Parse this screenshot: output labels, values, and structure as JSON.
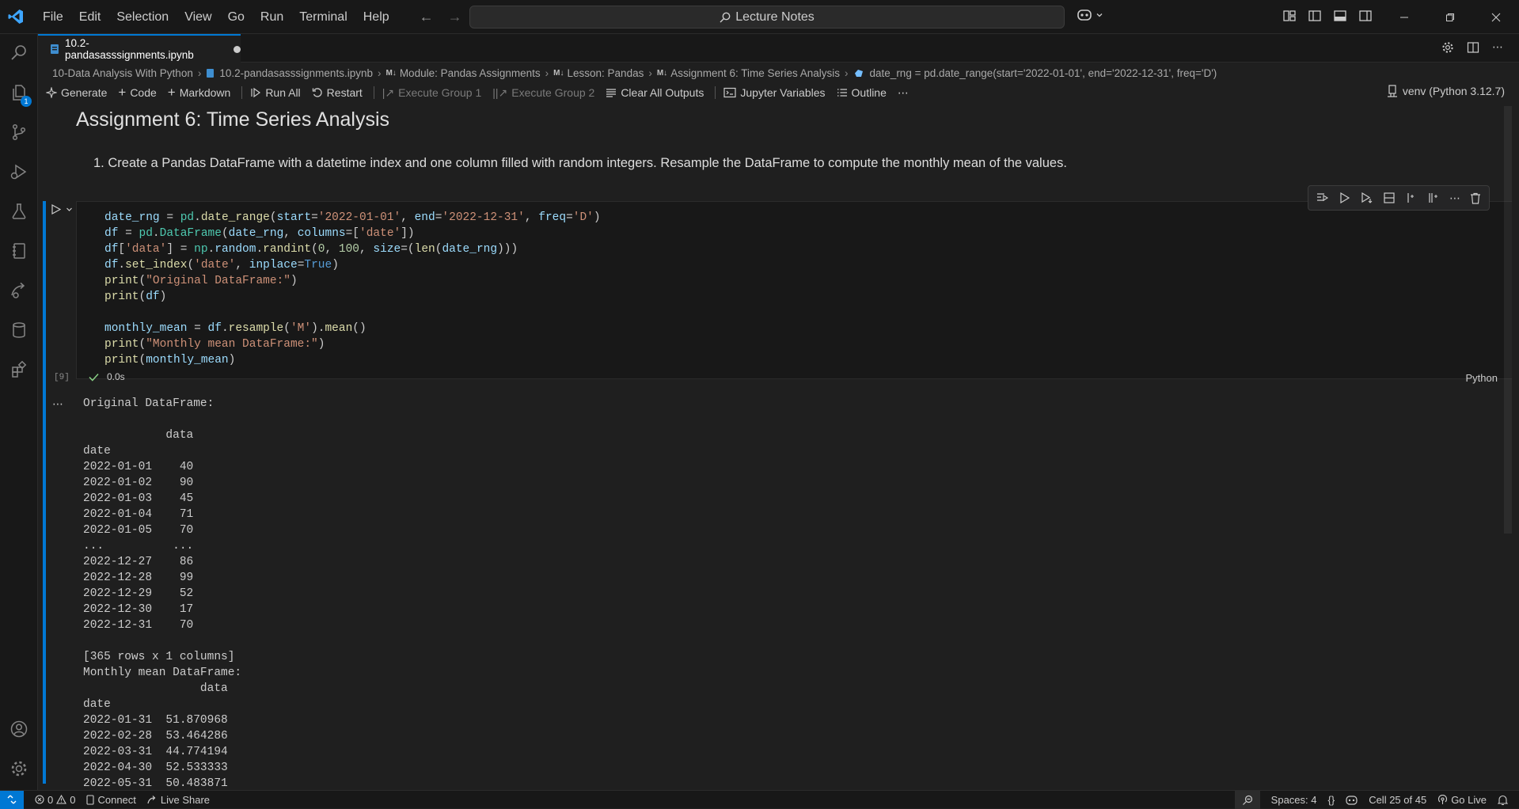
{
  "menu": [
    "File",
    "Edit",
    "Selection",
    "View",
    "Go",
    "Run",
    "Terminal",
    "Help"
  ],
  "search": {
    "text": "Lecture Notes"
  },
  "activity": {
    "explorer_badge": "1"
  },
  "tab": {
    "filename": "10.2-pandasasssignments.ipynb"
  },
  "breadcrumb": {
    "folder": "10-Data Analysis With Python",
    "file": "10.2-pandasasssignments.ipynb",
    "module": "Module: Pandas Assignments",
    "lesson": "Lesson: Pandas",
    "assignment": "Assignment 6: Time Series Analysis",
    "symbol": "date_rng = pd.date_range(start='2022-01-01', end='2022-12-31', freq='D')",
    "md_marker": "M↓"
  },
  "toolbar": {
    "generate": "Generate",
    "code": "Code",
    "markdown": "Markdown",
    "run_all": "Run All",
    "restart": "Restart",
    "exec_group_1": "Execute Group 1",
    "exec_group_2": "Execute Group 2",
    "clear_outputs": "Clear All Outputs",
    "jupyter_vars": "Jupyter Variables",
    "outline": "Outline",
    "more": "⋯",
    "kernel": "venv (Python 3.12.7)"
  },
  "markdown_cell": {
    "heading": "Assignment 6: Time Series Analysis",
    "item_number": "1.",
    "item": "Create a Pandas DataFrame with a datetime index and one column filled with random integers. Resample the DataFrame to compute the monthly mean of the values."
  },
  "code_cell": {
    "execution_count": "[9]",
    "duration": "0.0s",
    "language": "Python"
  },
  "output": {
    "text": "Original DataFrame:\n\n            data\ndate\n2022-01-01    40\n2022-01-02    90\n2022-01-03    45\n2022-01-04    71\n2022-01-05    70\n...          ...\n2022-12-27    86\n2022-12-28    99\n2022-12-29    52\n2022-12-30    17\n2022-12-31    70\n\n[365 rows x 1 columns]\nMonthly mean DataFrame:\n                 data\ndate\n2022-01-31  51.870968\n2022-02-28  53.464286\n2022-03-31  44.774194\n2022-04-30  52.533333\n2022-05-31  50.483871"
  },
  "statusbar": {
    "errors": "0",
    "warnings": "0",
    "connect": "Connect",
    "live_share": "Live Share",
    "spaces": "Spaces: 4",
    "braces": "{}",
    "cell_position": "Cell 25 of 45",
    "go_live": "Go Live"
  }
}
